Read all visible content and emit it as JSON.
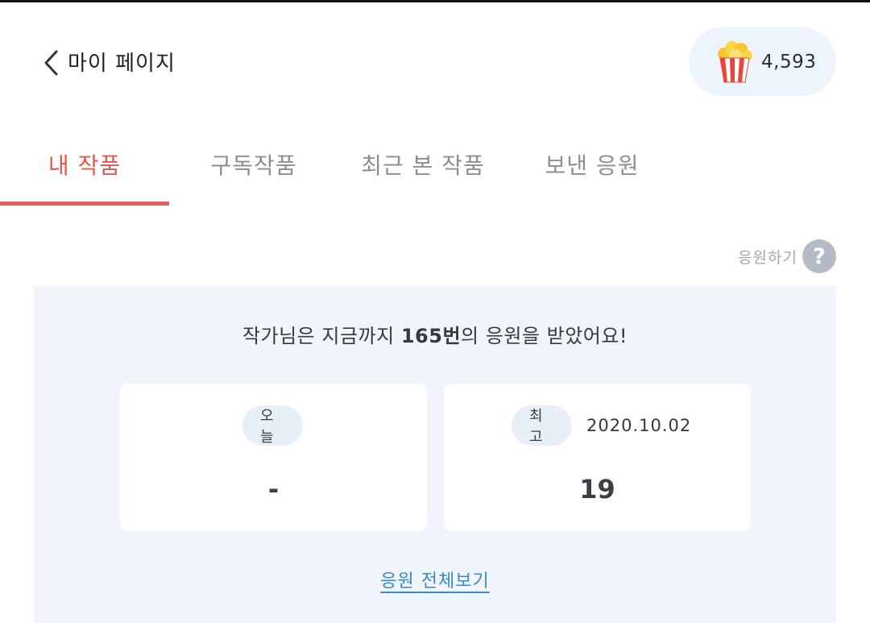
{
  "header": {
    "title": "마이 페이지",
    "points": "4,593",
    "back_icon": "chevron-left-icon",
    "points_icon": "popcorn-icon"
  },
  "tabs": [
    {
      "label": "내 작품",
      "active": true
    },
    {
      "label": "구독작품",
      "active": false
    },
    {
      "label": "최근 본 작품",
      "active": false
    },
    {
      "label": "보낸 응원",
      "active": false
    }
  ],
  "help": {
    "label": "응원하기",
    "icon": "question-icon",
    "glyph": "?"
  },
  "summary": {
    "prefix": "작가님은 지금까지 ",
    "count": "165번",
    "suffix": "의 응원을 받았어요!"
  },
  "stats": {
    "today_label": "오늘",
    "today_value": "-",
    "best_label": "최고",
    "best_date": "2020.10.02",
    "best_value": "19"
  },
  "view_all_label": "응원 전체보기",
  "colors": {
    "accent": "#e2584f",
    "panel_bg": "#f0f5fb",
    "link": "#3c89c9"
  }
}
